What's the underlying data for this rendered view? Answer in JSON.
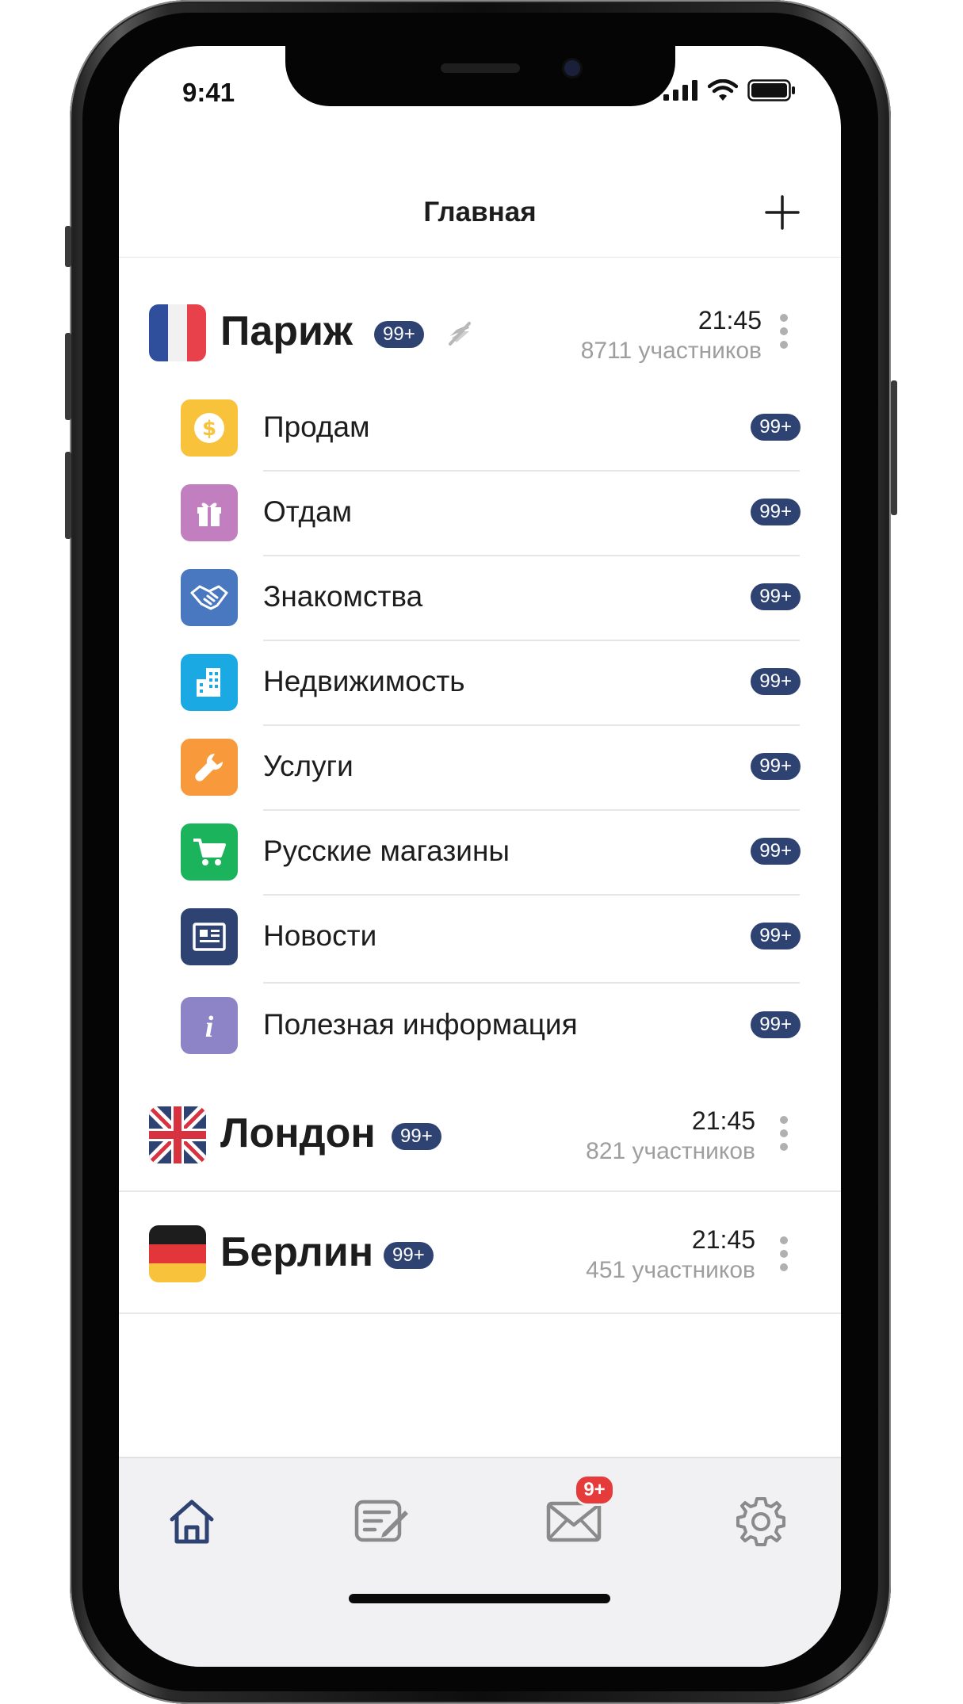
{
  "status": {
    "time": "9:41"
  },
  "header": {
    "title": "Главная"
  },
  "cities": [
    {
      "name": "Париж",
      "badge": "99+",
      "time": "21:45",
      "members": "8711 участников",
      "muted": true,
      "flag": "france-flag",
      "categories": [
        {
          "label": "Продам",
          "badge": "99+",
          "icon": "dollar-coin-icon",
          "color": "#F8C23A"
        },
        {
          "label": "Отдам",
          "badge": "99+",
          "icon": "gift-icon",
          "color": "#C17FBF"
        },
        {
          "label": "Знакомства",
          "badge": "99+",
          "icon": "handshake-icon",
          "color": "#4A78C0"
        },
        {
          "label": "Недвижимость",
          "badge": "99+",
          "icon": "building-icon",
          "color": "#1BA9E4"
        },
        {
          "label": "Услуги",
          "badge": "99+",
          "icon": "wrench-icon",
          "color": "#F8993B"
        },
        {
          "label": "Русские магазины",
          "badge": "99+",
          "icon": "shopping-cart-icon",
          "color": "#1BB35C"
        },
        {
          "label": "Новости",
          "badge": "99+",
          "icon": "newspaper-icon",
          "color": "#2F4373"
        },
        {
          "label": "Полезная информация",
          "badge": "99+",
          "icon": "info-icon",
          "color": "#8C84C6"
        }
      ]
    },
    {
      "name": "Лондон",
      "badge": "99+",
      "time": "21:45",
      "members": "821 участников",
      "flag": "uk-flag"
    },
    {
      "name": "Берлин",
      "badge": "99+",
      "time": "21:45",
      "members": "451 участников",
      "flag": "germany-flag"
    }
  ],
  "tabbar": {
    "tabs": [
      {
        "name": "home",
        "icon": "home-icon",
        "active": true
      },
      {
        "name": "compose",
        "icon": "compose-icon"
      },
      {
        "name": "messages",
        "icon": "mail-icon",
        "badge": "9+"
      },
      {
        "name": "settings",
        "icon": "gear-icon"
      }
    ]
  },
  "colors": {
    "badge": "#2F4373",
    "active_tab": "#2F4373",
    "inactive_tab": "#8A8A8A",
    "notification": "#E63B3B"
  }
}
